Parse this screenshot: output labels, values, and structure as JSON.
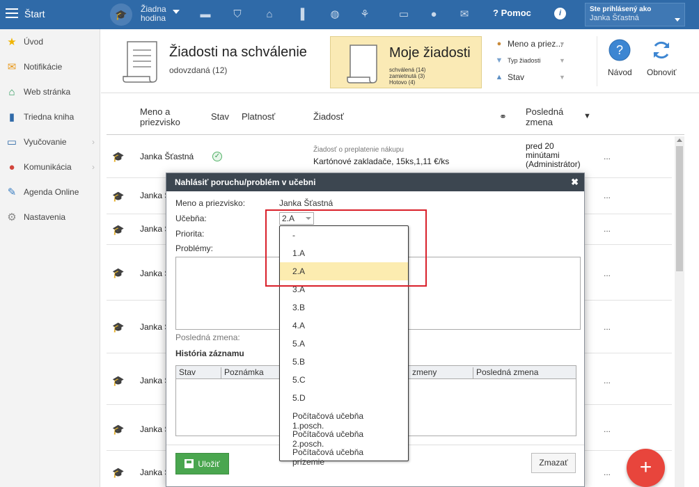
{
  "topbar": {
    "start_label": "Štart",
    "hour_line1": "Žiadna",
    "hour_line2": "hodina",
    "help_label": "Pomoc",
    "info_glyph": "i",
    "user_line1": "Ste prihlásený ako",
    "user_line2": "Janka Šťastná",
    "icons": [
      "briefcase-icon",
      "shield-icon",
      "bank-icon",
      "bar-chart-icon",
      "basketball-icon",
      "hiking-icon",
      "presentation-icon",
      "chat-icon",
      "mail-icon"
    ]
  },
  "sidebar": {
    "items": [
      {
        "label": "Úvod",
        "icon": "star-icon",
        "chevron": false
      },
      {
        "label": "Notifikácie",
        "icon": "envelope-icon",
        "chevron": false
      },
      {
        "label": "Web stránka",
        "icon": "home-icon",
        "chevron": false
      },
      {
        "label": "Triedna kniha",
        "icon": "book-icon",
        "chevron": false
      },
      {
        "label": "Vyučovanie",
        "icon": "open-book-icon",
        "chevron": true
      },
      {
        "label": "Komunikácia",
        "icon": "chat-icon",
        "chevron": true
      },
      {
        "label": "Agenda Online",
        "icon": "pen-icon",
        "chevron": false
      },
      {
        "label": "Nastavenia",
        "icon": "gear-icon",
        "chevron": false
      }
    ]
  },
  "header": {
    "approve_title": "Žiadosti na schválenie",
    "approve_sub": "odovzdaná (12)",
    "mine_title": "Moje žiadosti",
    "mine_stats": [
      "schválená (14)",
      "zamietnutá (3)",
      "Hotovo (4)"
    ],
    "filters": [
      "Meno a priez...",
      "Typ žiadosti",
      "Stav"
    ],
    "help_label": "Návod",
    "refresh_label": "Obnoviť",
    "help_glyph": "?"
  },
  "table": {
    "col_name": "Meno a priezvisko",
    "col_state": "Stav",
    "col_validity": "Platnosť",
    "col_request": "Žiadosť",
    "col_last_change": "Posledná zmena",
    "sort_glyph": "▼",
    "rows": [
      {
        "name": "Janka Šťastná",
        "request_type": "Žiadosť o preplatenie nákupu",
        "request_text": "Kartónové zakladače, 15ks,1,11 €/ks",
        "last_change": "pred 20 minútami (Administrátor)",
        "dots": "..."
      },
      {
        "name": "Janka Š",
        "dots": "..."
      },
      {
        "name": "Janka Š",
        "dots": "..."
      },
      {
        "name": "Janka Š",
        "dots": "..."
      },
      {
        "name": "Janka Š",
        "dots": "..."
      },
      {
        "name": "Janka Š",
        "dots": "..."
      },
      {
        "name": "Janka Š",
        "dots": "..."
      },
      {
        "name": "Janka Š",
        "dots": "..."
      }
    ]
  },
  "modal": {
    "title": "Nahlásiť poruchu/problém v učebni",
    "close_glyph": "✖",
    "name_label": "Meno a priezvisko:",
    "name_value": "Janka Šťastná",
    "room_label": "Učebňa:",
    "room_value": "2.A",
    "priority_label": "Priorita:",
    "problems_label": "Problémy:",
    "last_change_label": "Posledná zmena:",
    "history_label": "História záznamu",
    "history_cols": [
      "Stav",
      "Poznámka",
      "zmeny",
      "Posledná zmena"
    ],
    "save_label": "Uložiť",
    "clear_label": "Zmazať"
  },
  "dropdown": {
    "options": [
      "-",
      "1.A",
      "2.A",
      "3.A",
      "3.B",
      "4.A",
      "5.A",
      "5.B",
      "5.C",
      "5.D",
      "Počítačová učebňa 1.posch.",
      "Počítačová učebňa 2.posch.",
      "Počítačová učebňa prízemie"
    ],
    "selected": "2.A"
  },
  "fab": {
    "glyph": "+"
  }
}
